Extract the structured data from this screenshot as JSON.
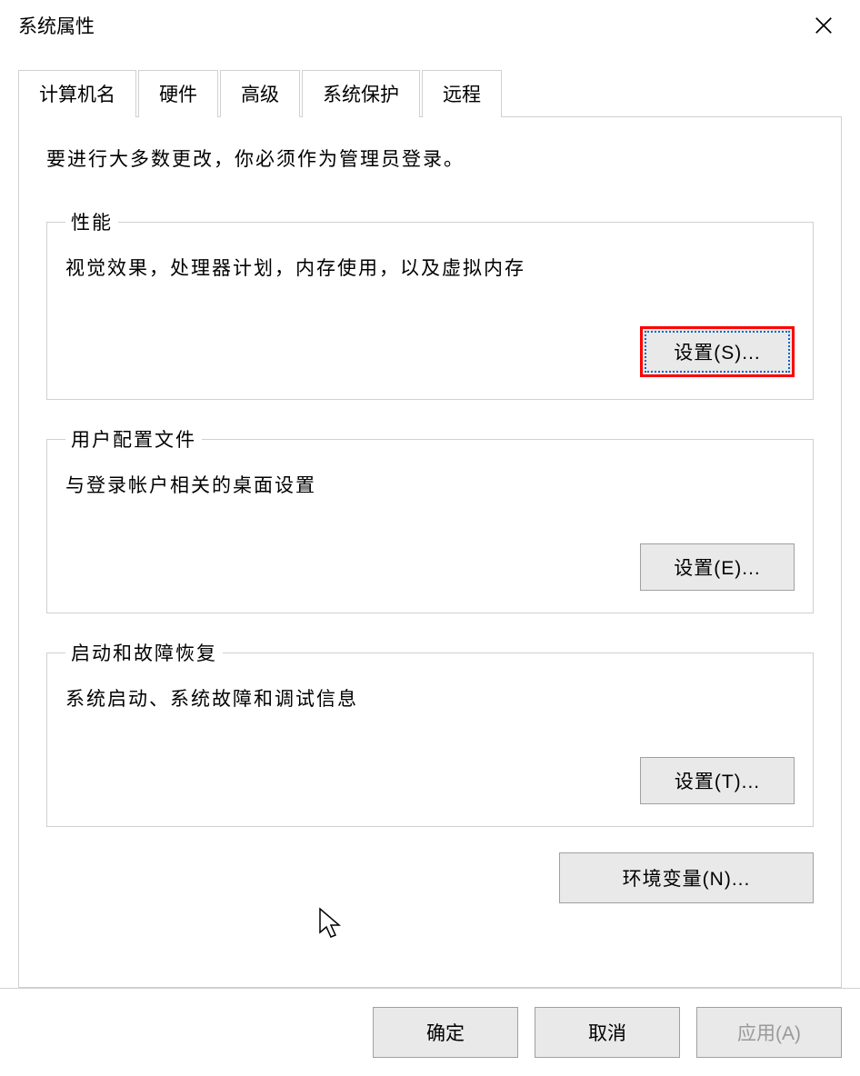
{
  "titlebar": {
    "title": "系统属性"
  },
  "tabs": [
    {
      "label": "计算机名"
    },
    {
      "label": "硬件"
    },
    {
      "label": "高级"
    },
    {
      "label": "系统保护"
    },
    {
      "label": "远程"
    }
  ],
  "content": {
    "info_text": "要进行大多数更改，你必须作为管理员登录。"
  },
  "groups": {
    "performance": {
      "legend": "性能",
      "desc": "视觉效果，处理器计划，内存使用，以及虚拟内存",
      "button": "设置(S)..."
    },
    "user_profiles": {
      "legend": "用户配置文件",
      "desc": "与登录帐户相关的桌面设置",
      "button": "设置(E)..."
    },
    "startup_recovery": {
      "legend": "启动和故障恢复",
      "desc": "系统启动、系统故障和调试信息",
      "button": "设置(T)..."
    }
  },
  "env_button": "环境变量(N)...",
  "footer": {
    "ok": "确定",
    "cancel": "取消",
    "apply": "应用(A)"
  }
}
